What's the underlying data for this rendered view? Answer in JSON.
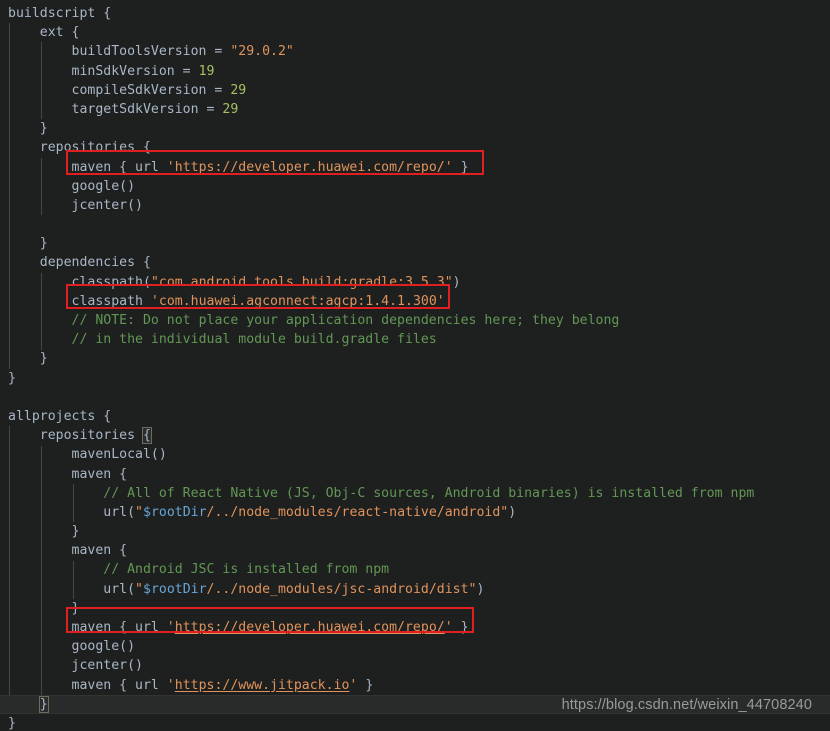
{
  "editor": {
    "language": "gradle",
    "theme": "darcula",
    "background_color": "#1e1f1f",
    "default_text_color": "#a9b7c6",
    "colors": {
      "identifier": "#a9b7c6",
      "string": "#e0935c",
      "number": "#a5c261",
      "comment": "#629755",
      "template_variable": "#68a5d6",
      "indent_guide": "#454747",
      "current_line_highlight": "#292b2b",
      "bracket_match_outline": "#6d6d5e",
      "annotation_box": "#e02020"
    },
    "lines": [
      {
        "n": 1,
        "indent": 0,
        "text": "buildscript {"
      },
      {
        "n": 2,
        "indent": 1,
        "text": "ext {"
      },
      {
        "n": 3,
        "indent": 2,
        "text": "buildToolsVersion = \"29.0.2\""
      },
      {
        "n": 4,
        "indent": 2,
        "text": "minSdkVersion = 19"
      },
      {
        "n": 5,
        "indent": 2,
        "text": "compileSdkVersion = 29"
      },
      {
        "n": 6,
        "indent": 2,
        "text": "targetSdkVersion = 29"
      },
      {
        "n": 7,
        "indent": 1,
        "text": "}"
      },
      {
        "n": 8,
        "indent": 1,
        "text": "repositories {"
      },
      {
        "n": 9,
        "indent": 2,
        "text": "maven { url 'https://developer.huawei.com/repo/' }"
      },
      {
        "n": 10,
        "indent": 2,
        "text": "google()"
      },
      {
        "n": 11,
        "indent": 2,
        "text": "jcenter()"
      },
      {
        "n": 12,
        "indent": 0,
        "text": ""
      },
      {
        "n": 13,
        "indent": 1,
        "text": "}"
      },
      {
        "n": 14,
        "indent": 1,
        "text": "dependencies {"
      },
      {
        "n": 15,
        "indent": 2,
        "text": "classpath(\"com.android.tools.build:gradle:3.5.3\")"
      },
      {
        "n": 16,
        "indent": 2,
        "text": "classpath 'com.huawei.agconnect:agcp:1.4.1.300'"
      },
      {
        "n": 17,
        "indent": 2,
        "text": "// NOTE: Do not place your application dependencies here; they belong"
      },
      {
        "n": 18,
        "indent": 2,
        "text": "// in the individual module build.gradle files"
      },
      {
        "n": 19,
        "indent": 1,
        "text": "}"
      },
      {
        "n": 20,
        "indent": 0,
        "text": "}"
      },
      {
        "n": 21,
        "indent": 0,
        "text": ""
      },
      {
        "n": 22,
        "indent": 0,
        "text": "allprojects {"
      },
      {
        "n": 23,
        "indent": 1,
        "text": "repositories {"
      },
      {
        "n": 24,
        "indent": 2,
        "text": "mavenLocal()"
      },
      {
        "n": 25,
        "indent": 2,
        "text": "maven {"
      },
      {
        "n": 26,
        "indent": 3,
        "text": "// All of React Native (JS, Obj-C sources, Android binaries) is installed from npm"
      },
      {
        "n": 27,
        "indent": 3,
        "text": "url(\"$rootDir/../node_modules/react-native/android\")"
      },
      {
        "n": 28,
        "indent": 2,
        "text": "}"
      },
      {
        "n": 29,
        "indent": 2,
        "text": "maven {"
      },
      {
        "n": 30,
        "indent": 3,
        "text": "// Android JSC is installed from npm"
      },
      {
        "n": 31,
        "indent": 3,
        "text": "url(\"$rootDir/../node_modules/jsc-android/dist\")"
      },
      {
        "n": 32,
        "indent": 2,
        "text": "}"
      },
      {
        "n": 33,
        "indent": 2,
        "text": "maven { url 'https://developer.huawei.com/repo/' }"
      },
      {
        "n": 34,
        "indent": 2,
        "text": "google()"
      },
      {
        "n": 35,
        "indent": 2,
        "text": "jcenter()"
      },
      {
        "n": 36,
        "indent": 2,
        "text": "maven { url 'https://www.jitpack.io' }"
      },
      {
        "n": 37,
        "indent": 1,
        "text": "}"
      },
      {
        "n": 38,
        "indent": 0,
        "text": "}"
      }
    ],
    "annotations": [
      {
        "label": "huawei-maven-repo-buildscript",
        "target_line": 9
      },
      {
        "label": "huawei-agcp-classpath",
        "target_line": 16
      },
      {
        "label": "huawei-maven-repo-allprojects",
        "target_line": 33
      }
    ],
    "bracket_matches": [
      23,
      37
    ],
    "current_line": 37
  },
  "watermark": {
    "text": "https://blog.csdn.net/weixin_44708240"
  }
}
